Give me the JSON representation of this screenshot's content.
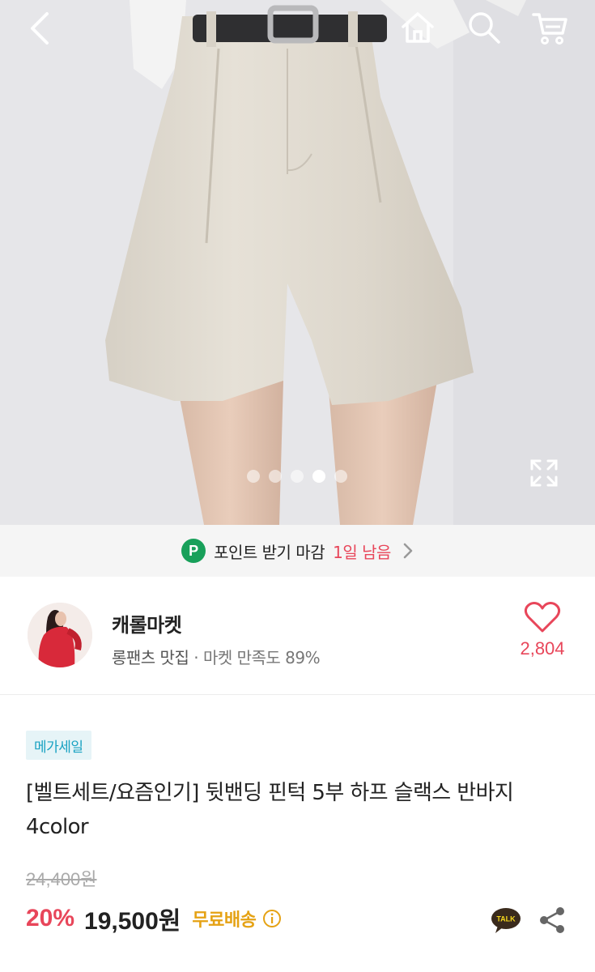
{
  "header": {
    "back_icon": "chevron-left-icon",
    "home_icon": "home-icon",
    "search_icon": "search-icon",
    "cart_icon": "cart-icon"
  },
  "gallery": {
    "slide_count": 5,
    "active_slide": 4,
    "expand_icon": "expand-icon"
  },
  "point_banner": {
    "badge": "P",
    "text": "포인트 받기 마감",
    "remaining": "1일 남음",
    "badge_color": "#18a05a",
    "highlight_color": "#e8465a"
  },
  "seller": {
    "name": "캐롤마켓",
    "tag": "롱팬츠 맛집",
    "separator": "·",
    "satisfaction": "마켓 만족도 89%",
    "like_count": "2,804"
  },
  "product": {
    "badge": "메가세일",
    "title": "[벨트세트/요즘인기] 뒷밴딩 핀턱 5부 하프 슬랙스 반바지 4color",
    "original_price": "24,400원",
    "discount": "20%",
    "price": "19,500원",
    "shipping": "무료배송",
    "talk_label": "TALK",
    "accent_color": "#e8465a",
    "shipping_color": "#e5a214"
  }
}
